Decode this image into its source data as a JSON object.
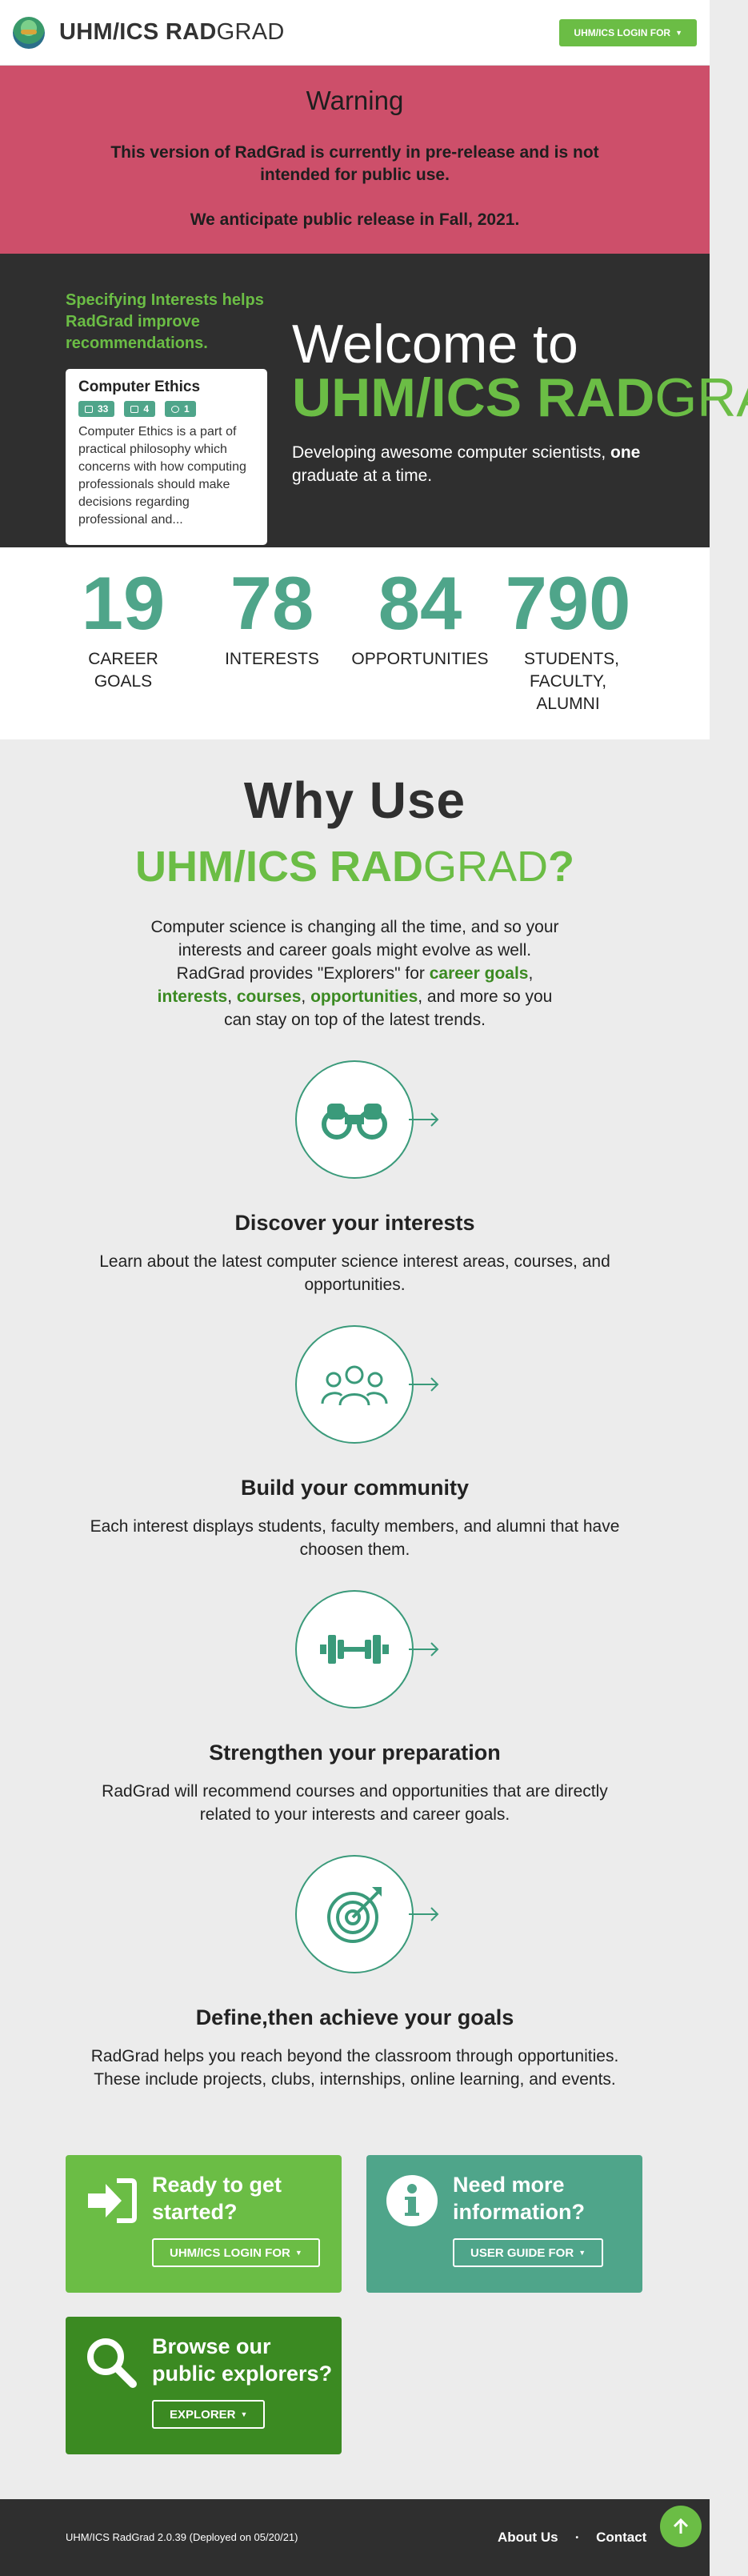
{
  "header": {
    "brand_prefix": "UHM/ICS RAD",
    "brand_suffix": "GRAD",
    "login_label": "UHM/ICS LOGIN FOR"
  },
  "warning": {
    "title": "Warning",
    "line1": "This version of RadGrad is currently in pre-release and is not intended for public use.",
    "line2": "We anticipate public release in Fall, 2021."
  },
  "hero": {
    "tagline": "Specifying Interests helps RadGrad improve recommendations.",
    "card": {
      "title": "Computer Ethics",
      "badges": [
        "33",
        "4",
        "1"
      ],
      "text": "Computer Ethics is a part of practical philosophy which concerns with how computing professionals should make decisions regarding professional and..."
    },
    "welcome": "Welcome to",
    "brand_bold": "UHM/ICS RAD",
    "brand_light": "GRAD",
    "subtitle_start": "Developing awesome computer scientists, ",
    "subtitle_bold": "one",
    "subtitle_end": " graduate at a time."
  },
  "stats": [
    {
      "value": "19",
      "label": "CAREER GOALS"
    },
    {
      "value": "78",
      "label": "INTERESTS"
    },
    {
      "value": "84",
      "label": "OPPORTUNITIES"
    },
    {
      "value": "790",
      "label": "STUDENTS, FACULTY, ALUMNI"
    }
  ],
  "why": {
    "title": "Why Use",
    "brand_bold": "UHM/ICS RAD",
    "brand_light": "GRAD",
    "qmark": "?",
    "intro_a": "Computer science is changing all the time, and so your interests and career goals might evolve as well. RadGrad provides \"Explorers\" for ",
    "hl1": "career goals",
    "sep1": ", ",
    "hl2": "interests",
    "sep2": ", ",
    "hl3": "courses",
    "sep3": ", ",
    "hl4": "opportunities",
    "intro_b": ", and more so you can stay on top of the latest trends."
  },
  "features": [
    {
      "icon": "binoculars-icon",
      "title": "Discover your interests",
      "text": "Learn about the latest computer science interest areas, courses, and opportunities."
    },
    {
      "icon": "users-icon",
      "title": "Build your community",
      "text": "Each interest displays students, faculty members, and alumni that have choosen them."
    },
    {
      "icon": "dumbbell-icon",
      "title": "Strengthen your preparation",
      "text": "RadGrad will recommend courses and opportunities that are directly related to your interests and career goals."
    },
    {
      "icon": "target-icon",
      "title": "Define,then achieve your goals",
      "text": "RadGrad helps you reach beyond the classroom through opportunities. These include projects, clubs, internships, online learning, and events."
    }
  ],
  "cta": {
    "start_title": "Ready to get started?",
    "start_button": "UHM/ICS LOGIN FOR",
    "info_title": "Need more information?",
    "info_button": "USER GUIDE FOR",
    "browse_title": "Browse our public explorers?",
    "browse_button": "EXPLORER"
  },
  "footer": {
    "version": "UHM/ICS RadGrad 2.0.39 (Deployed on 05/20/21)",
    "about": "About Us",
    "contact": "Contact"
  },
  "colors": {
    "green": "#6bbd45",
    "teal": "#4fa58a",
    "dark_green": "#3b8a22",
    "warning": "#cd4f6a",
    "dark": "#2f2f2f"
  }
}
